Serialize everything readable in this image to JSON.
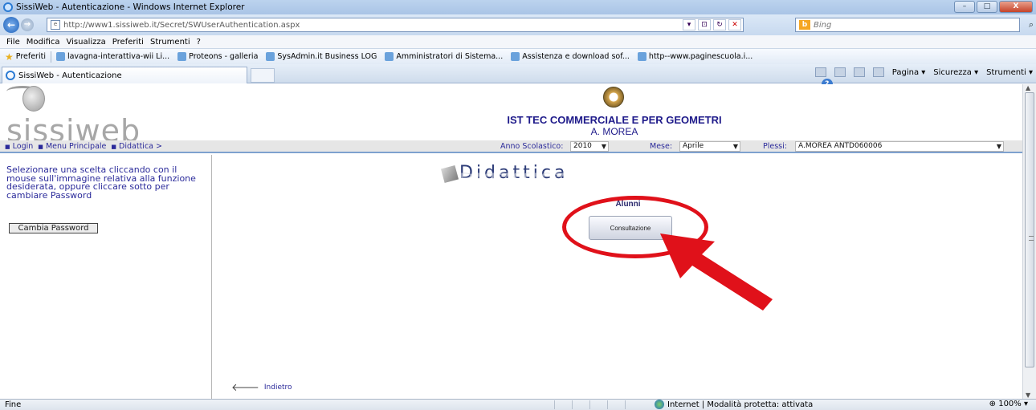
{
  "window": {
    "title": "SissiWeb - Autenticazione - Windows Internet Explorer",
    "min": "–",
    "max": "□",
    "close": "X"
  },
  "address": {
    "url": "http://www1.sissiweb.it/Secret/SWUserAuthentication.aspx",
    "search_placeholder": "Bing",
    "search_engine_icon": "b"
  },
  "menu": [
    "File",
    "Modifica",
    "Visualizza",
    "Preferiti",
    "Strumenti",
    "?"
  ],
  "favorites": {
    "label": "Preferiti",
    "items": [
      "lavagna-interattiva-wii Li...",
      "Proteons - galleria",
      "SysAdmin.it Business LOG",
      "Amministratori di Sistema...",
      "Assistenza e download sof...",
      "http--www.paginescuola.i..."
    ]
  },
  "tab": {
    "label": "SissiWeb - Autenticazione"
  },
  "commands": [
    "Pagina ▾",
    "Sicurezza ▾",
    "Strumenti ▾"
  ],
  "site": {
    "logo_text": "sissiweb",
    "school_name": "IST TEC COMMERCIALE E PER GEOMETRI",
    "school_sub": "A. MOREA"
  },
  "nav": {
    "crumbs": [
      "Login",
      "Menu Principale",
      "Didattica >"
    ],
    "anno_label": "Anno Scolastico:",
    "anno_value": "2010",
    "mese_label": "Mese:",
    "mese_value": "Aprile",
    "plessi_label": "Plessi:",
    "plessi_value": "A.MOREA ANTD060006"
  },
  "left": {
    "help_text": "Selezionare una scelta cliccando con il mouse sull'immagine relativa alla funzione desiderata, oppure cliccare sotto per cambiare Password",
    "cambia_label": "Cambia Password"
  },
  "main": {
    "section_title": "Didattica",
    "group_label": "Alunni",
    "consult_label": "Consultazione",
    "back_label": "Indietro"
  },
  "annotation": {
    "highlight_color": "#e0111a"
  },
  "status": {
    "left": "Fine",
    "zone": "Internet | Modalità protetta: attivata",
    "zoom": "100%"
  }
}
